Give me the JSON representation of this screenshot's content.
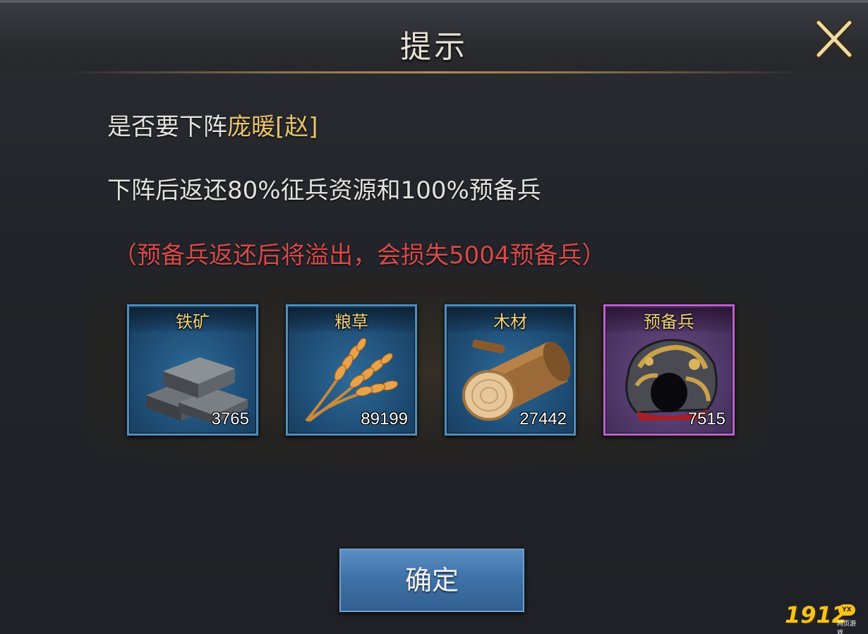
{
  "dialog": {
    "title": "提示",
    "message_prefix": "是否要下阵",
    "general_name": "庞暖[赵]",
    "message_line2": "下阵后返还80%征兵资源和100%预备兵",
    "warning": "（预备兵返还后将溢出，会损失5004预备兵）",
    "confirm_label": "确定"
  },
  "items": [
    {
      "name": "铁矿",
      "count": "3765",
      "icon": "iron-ingot-icon"
    },
    {
      "name": "粮草",
      "count": "89199",
      "icon": "wheat-icon"
    },
    {
      "name": "木材",
      "count": "27442",
      "icon": "log-icon"
    },
    {
      "name": "预备兵",
      "count": "7515",
      "icon": "armor-helmet-icon"
    }
  ],
  "colors": {
    "general_name": "#e9c46a",
    "warning": "#d94a4a",
    "blue_frame": "#4f8fbf",
    "purple_frame": "#c25fd0"
  },
  "watermark": {
    "number": "1912",
    "badge": "YX",
    "subtitle": "网页游戏"
  }
}
